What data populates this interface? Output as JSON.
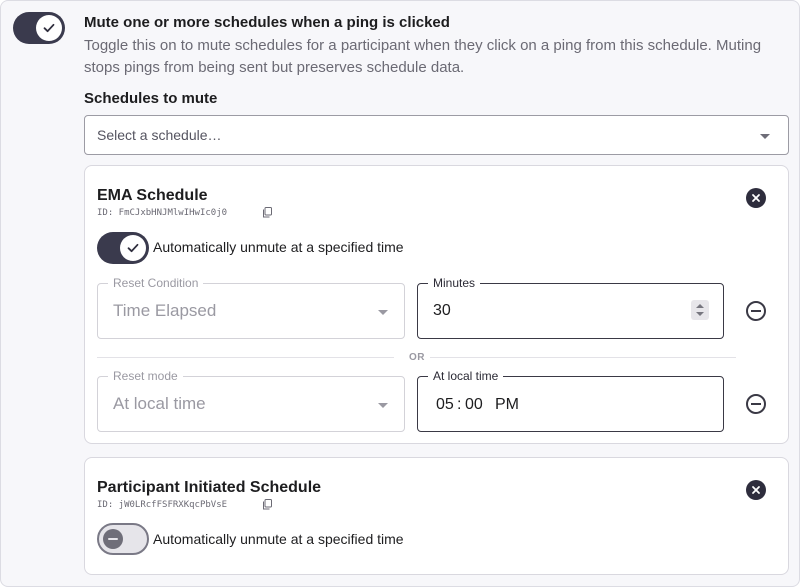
{
  "mute": {
    "toggle_on": true,
    "title": "Mute one or more schedules when a ping is clicked",
    "description": "Toggle this on to mute schedules for a participant when they click on a ping from this schedule. Muting stops pings from being sent but preserves schedule data.",
    "schedules_label": "Schedules to mute",
    "select_placeholder": "Select a schedule…"
  },
  "schedules": [
    {
      "name": "EMA Schedule",
      "id_text": "ID: FmCJxbHNJMlwIHwIc0j0",
      "auto_unmute_on": true,
      "auto_unmute_label": "Automatically unmute at a specified time",
      "reset_condition_legend": "Reset Condition",
      "reset_condition_value": "Time Elapsed",
      "minutes_legend": "Minutes",
      "minutes_value": "30",
      "or_text": "OR",
      "reset_mode_legend": "Reset mode",
      "reset_mode_value": "At local time",
      "local_time_legend": "At local time",
      "time_hour": "05",
      "time_minute": "00",
      "time_ampm": "PM"
    },
    {
      "name": "Participant Initiated Schedule",
      "id_text": "ID: jW0LRcfFSFRXKqcPbVsE",
      "auto_unmute_on": false,
      "auto_unmute_label": "Automatically unmute at a specified time"
    }
  ]
}
